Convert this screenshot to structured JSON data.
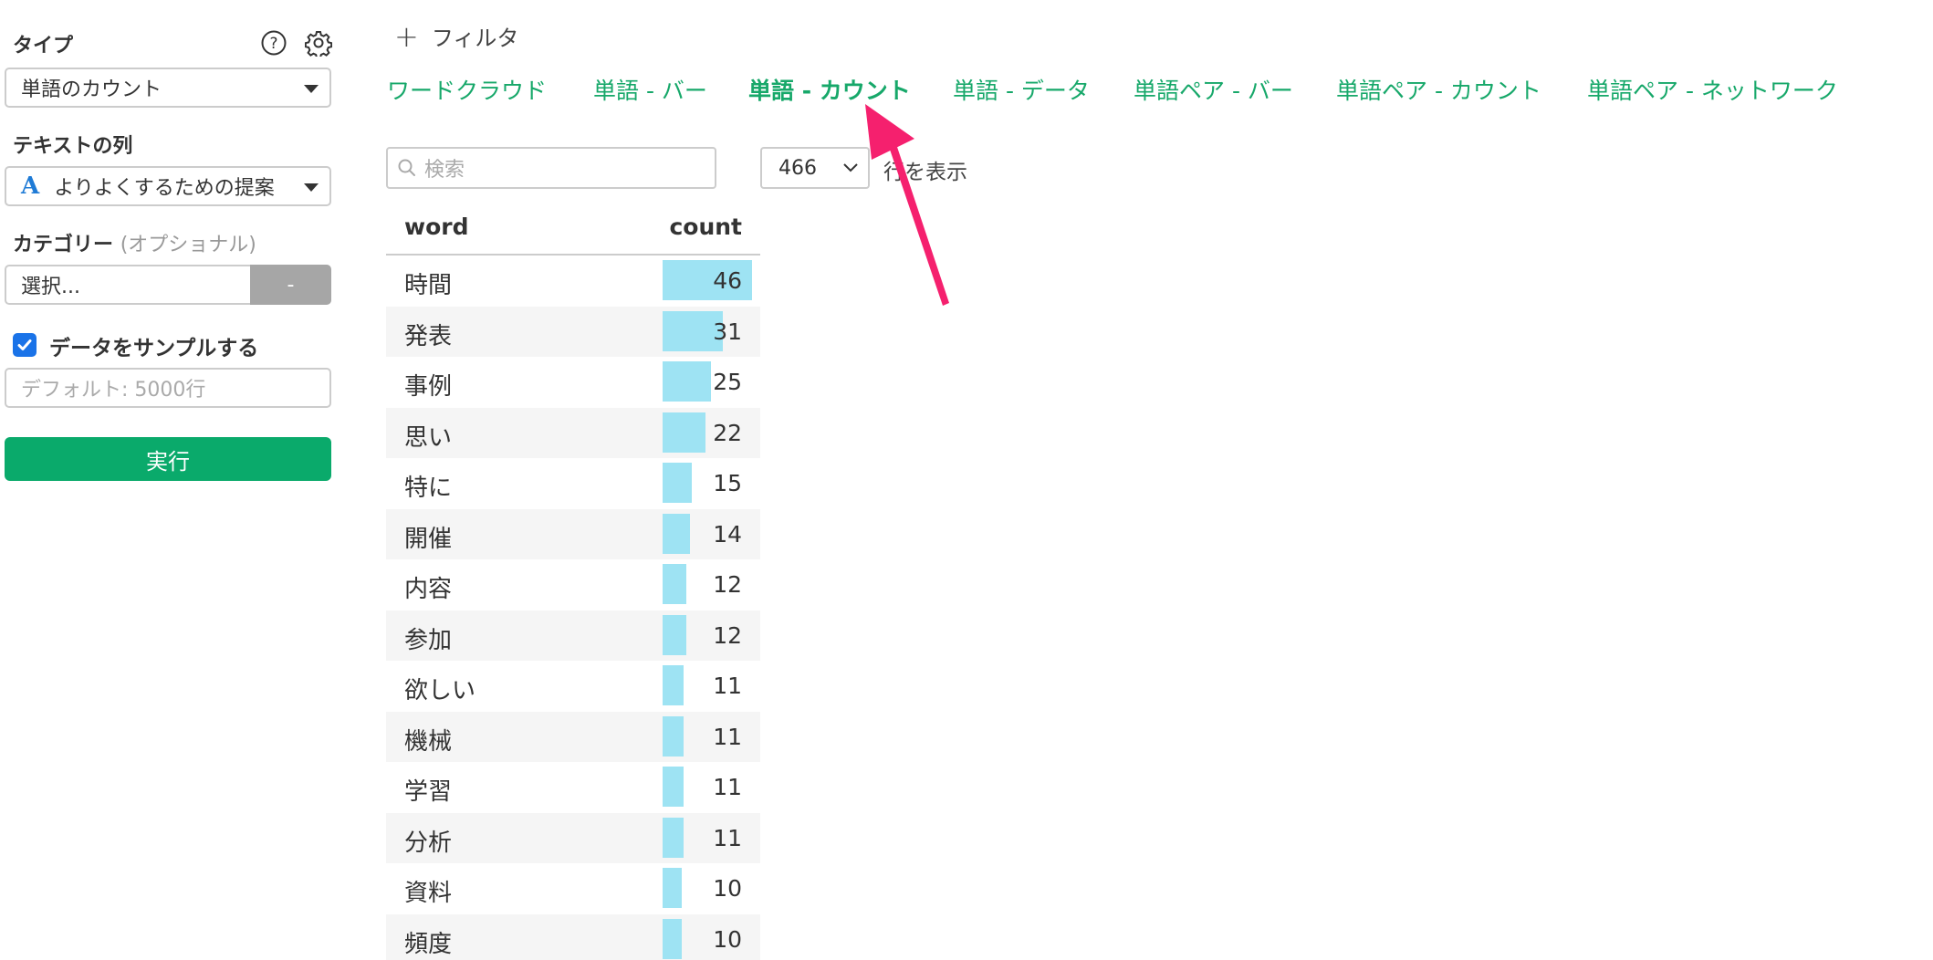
{
  "sidebar": {
    "type_label": "タイプ",
    "type_value": "単語のカウント",
    "text_column_label": "テキストの列",
    "text_column_type_icon": "A",
    "text_column_value": "よりよくするための提案",
    "category_label": "カテゴリー",
    "category_optional": "(オプショナル)",
    "category_placeholder": "選択...",
    "category_button": "-",
    "sample_label": "データをサンプルする",
    "sample_checked": true,
    "sample_placeholder": "デフォルト: 5000行",
    "run_label": "実行"
  },
  "filter": {
    "plus": "+",
    "label": "フィルタ"
  },
  "tabs": [
    {
      "label": "ワードクラウド",
      "active": false
    },
    {
      "label": "単語 - バー",
      "active": false
    },
    {
      "label": "単語 - カウント",
      "active": true
    },
    {
      "label": "単語 - データ",
      "active": false
    },
    {
      "label": "単語ペア - バー",
      "active": false
    },
    {
      "label": "単語ペア - カウント",
      "active": false
    },
    {
      "label": "単語ペア - ネットワーク",
      "active": false
    }
  ],
  "search": {
    "placeholder": "検索"
  },
  "rows": {
    "value": "466",
    "label": "行を表示"
  },
  "table": {
    "headers": {
      "word": "word",
      "count": "count"
    },
    "max_count": 46,
    "rows": [
      {
        "word": "時間",
        "count": "46"
      },
      {
        "word": "発表",
        "count": "31"
      },
      {
        "word": "事例",
        "count": "25"
      },
      {
        "word": "思い",
        "count": "22"
      },
      {
        "word": "特に",
        "count": "15"
      },
      {
        "word": "開催",
        "count": "14"
      },
      {
        "word": "内容",
        "count": "12"
      },
      {
        "word": "参加",
        "count": "12"
      },
      {
        "word": "欲しい",
        "count": "11"
      },
      {
        "word": "機械",
        "count": "11"
      },
      {
        "word": "学習",
        "count": "11"
      },
      {
        "word": "分析",
        "count": "11"
      },
      {
        "word": "資料",
        "count": "10"
      },
      {
        "word": "頻度",
        "count": "10"
      }
    ]
  },
  "colors": {
    "accent": "#17a86a",
    "run_button": "#0aaa6b",
    "bar": "#9ee3f3",
    "arrow": "#f5206e"
  },
  "icons": {
    "help": "help-icon",
    "settings": "gear-icon",
    "search": "search-icon",
    "dropdown": "chevron-down-icon",
    "annotation": "arrow-annotation"
  }
}
